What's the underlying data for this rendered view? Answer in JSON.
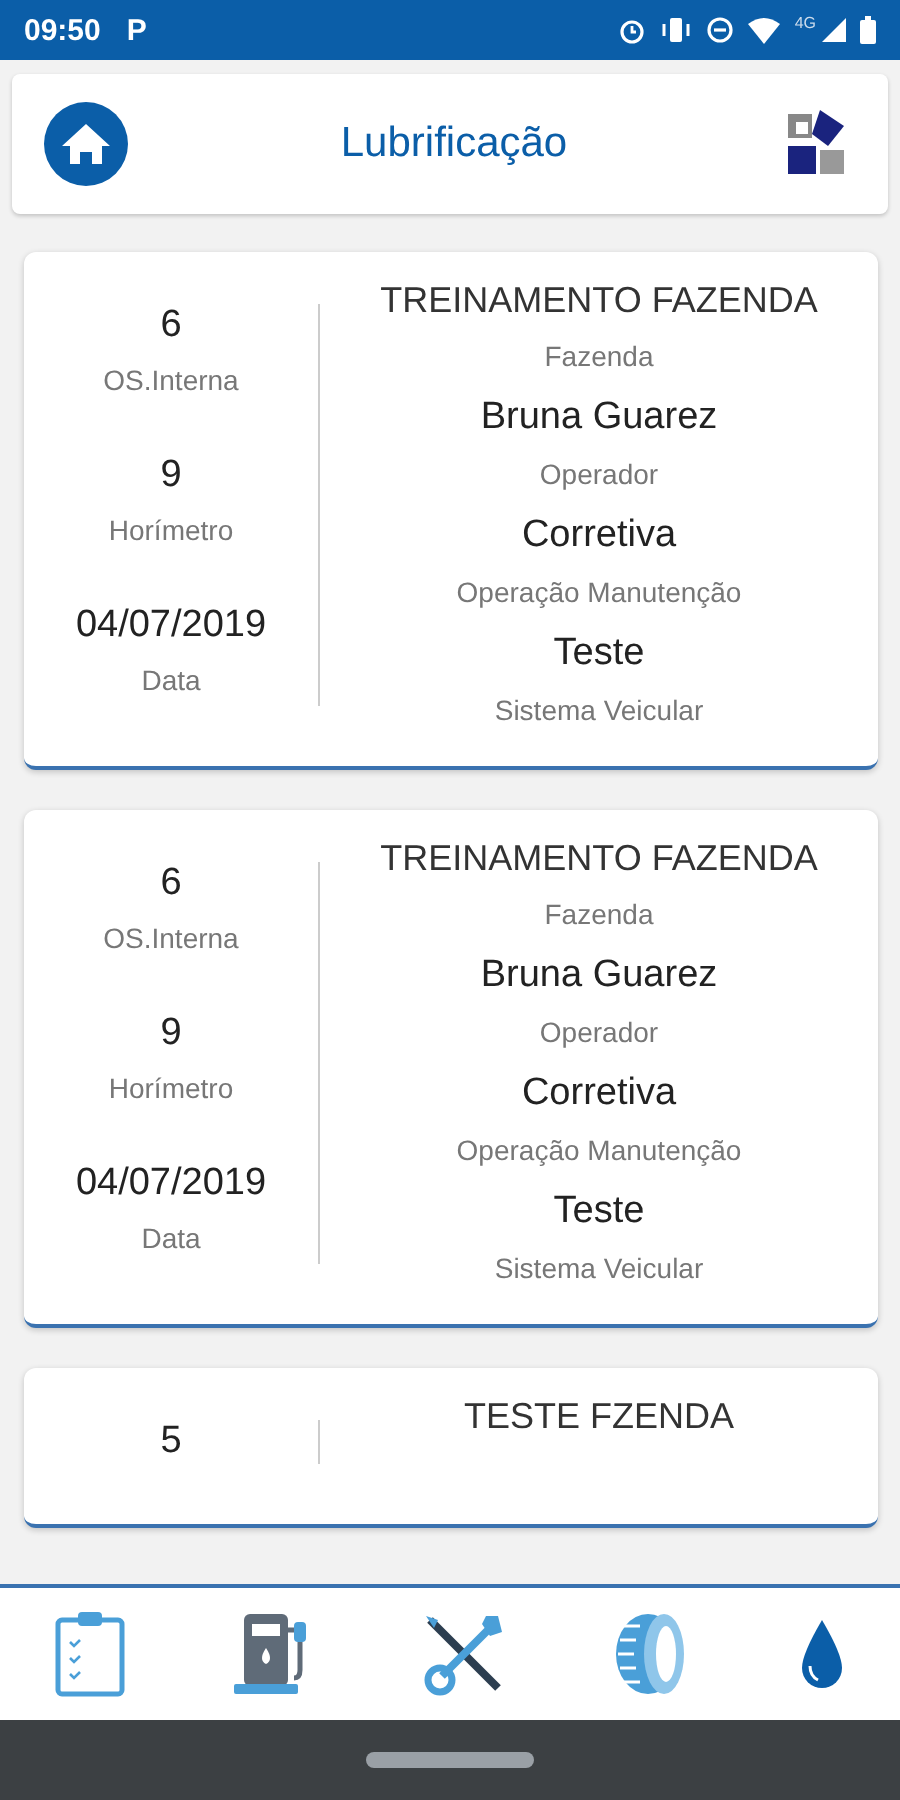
{
  "status_bar": {
    "time": "09:50",
    "notification": "P",
    "network": "4G"
  },
  "header": {
    "title": "Lubrificação"
  },
  "cards": [
    {
      "left": [
        {
          "value": "6",
          "label": "OS.Interna"
        },
        {
          "value": "9",
          "label": "Horímetro"
        },
        {
          "value": "04/07/2019",
          "label": "Data"
        }
      ],
      "right": [
        {
          "value": "TREINAMENTO FAZENDA",
          "label": "Fazenda"
        },
        {
          "value": "Bruna Guarez",
          "label": "Operador"
        },
        {
          "value": "Corretiva",
          "label": "Operação Manutenção"
        },
        {
          "value": "Teste",
          "label": "Sistema Veicular"
        }
      ]
    },
    {
      "left": [
        {
          "value": "6",
          "label": "OS.Interna"
        },
        {
          "value": "9",
          "label": "Horímetro"
        },
        {
          "value": "04/07/2019",
          "label": "Data"
        }
      ],
      "right": [
        {
          "value": "TREINAMENTO FAZENDA",
          "label": "Fazenda"
        },
        {
          "value": "Bruna Guarez",
          "label": "Operador"
        },
        {
          "value": "Corretiva",
          "label": "Operação Manutenção"
        },
        {
          "value": "Teste",
          "label": "Sistema Veicular"
        }
      ]
    },
    {
      "left": [
        {
          "value": "5"
        }
      ],
      "right": [
        {
          "value": "TESTE FZENDA"
        }
      ]
    }
  ],
  "bottom_nav": [
    {
      "kind": "checklist",
      "selected": false
    },
    {
      "kind": "fuel",
      "selected": false
    },
    {
      "kind": "tools",
      "selected": false
    },
    {
      "kind": "tire",
      "selected": false
    },
    {
      "kind": "drop",
      "selected": true
    }
  ]
}
